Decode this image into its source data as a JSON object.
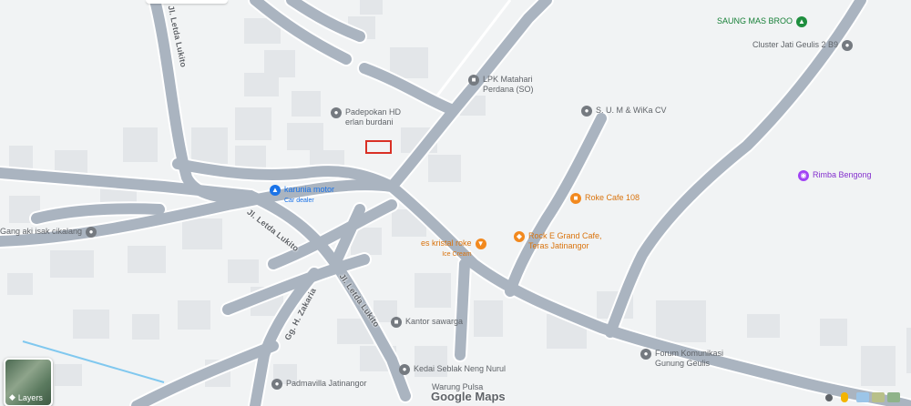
{
  "map": {
    "colors": {
      "background": "#f1f3f4",
      "road": "#aab4c0",
      "road_outline": "#ffffff",
      "building": "#e3e6e9",
      "water": "#80c8ef"
    },
    "streets": [
      {
        "id": "letda-lukito-north",
        "label": "Jl. Letda Lukito"
      },
      {
        "id": "letda-lukito-mid",
        "label": "Jl. Letda Lukito"
      },
      {
        "id": "letda-lukito-south",
        "label": "Jl. Letda Lukito"
      },
      {
        "id": "gg-h-zakaria",
        "label": "Gg. H. Zakaria"
      }
    ],
    "pois": [
      {
        "id": "saung-mas-broo",
        "name": "SAUNG MAS BROO",
        "sub": "",
        "icon": "pin-icon",
        "color": "green"
      },
      {
        "id": "cluster-jati-geulis",
        "name": "Cluster Jati Geulis 2 B9",
        "sub": "",
        "icon": "pin-icon",
        "color": "gray"
      },
      {
        "id": "lpk-matahari",
        "name": "LPK Matahari",
        "sub": "Perdana (SO)",
        "icon": "school-icon",
        "color": "gray"
      },
      {
        "id": "padepokan-hd",
        "name": "Padepokan HD",
        "sub": "erlan burdani",
        "icon": "pin-icon",
        "color": "gray"
      },
      {
        "id": "sum-wika",
        "name": "S. U. M & WiKa CV",
        "sub": "",
        "icon": "pin-icon",
        "color": "gray"
      },
      {
        "id": "karunia-motor",
        "name": "karunia motor",
        "sub": "Car dealer",
        "icon": "car-icon",
        "color": "blue"
      },
      {
        "id": "rimba-bengong",
        "name": "Rimba Bengong",
        "sub": "",
        "icon": "camera-icon",
        "color": "purple"
      },
      {
        "id": "roke-cafe",
        "name": "Roke Cafe 108",
        "sub": "",
        "icon": "cafe-icon",
        "color": "orange"
      },
      {
        "id": "gang-aki",
        "name": "Gang aki isak cikalang",
        "sub": "",
        "icon": "pin-icon",
        "color": "gray"
      },
      {
        "id": "rock-e-grand",
        "name": "Rock E Grand Cafe,",
        "sub": "Teras Jatinangor",
        "icon": "restaurant-icon",
        "color": "orange"
      },
      {
        "id": "es-kristal",
        "name": "es kristal roke",
        "sub": "Ice Cream",
        "icon": "ice-cream-icon",
        "color": "orange"
      },
      {
        "id": "kantor-sawarga",
        "name": "Kantor sawarga",
        "sub": "",
        "icon": "building-icon",
        "color": "gray"
      },
      {
        "id": "forum-komunikasi",
        "name": "Forum Komunikasi",
        "sub": "Gunung Geulis",
        "icon": "pin-icon",
        "color": "gray"
      },
      {
        "id": "kedai-seblak",
        "name": "Kedai Seblak Neng Nurul",
        "sub": "",
        "icon": "pin-icon",
        "color": "gray"
      },
      {
        "id": "warung-pulsa",
        "name": "Warung Pulsa",
        "sub": "",
        "icon": "pin-icon",
        "color": "gray"
      },
      {
        "id": "padmavilla",
        "name": "Padmavilla Jatinangor",
        "sub": "",
        "icon": "pin-icon",
        "color": "gray"
      }
    ],
    "layers_label": "Layers",
    "brand": "Google Maps"
  }
}
